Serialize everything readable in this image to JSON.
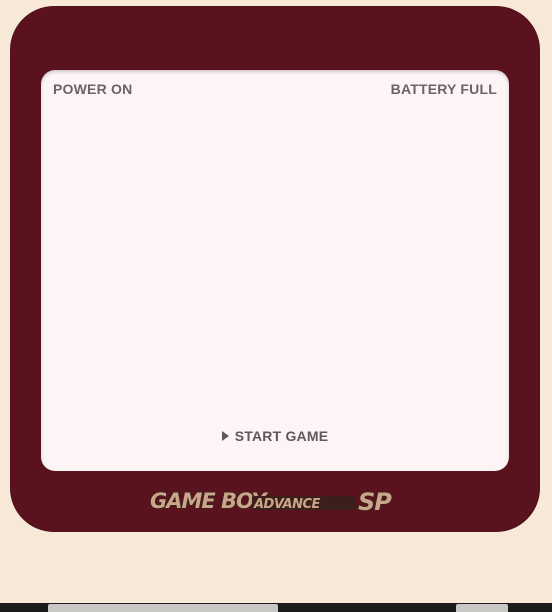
{
  "screen": {
    "status_left": "POWER ON",
    "status_right": "BATTERY FULL",
    "menu": {
      "selected_label": "START GAME",
      "cursor_icon": "play-triangle-icon"
    }
  },
  "logo": {
    "text_main": "GAME BOY",
    "text_advance": "ADVANCE",
    "text_sp": "SP"
  },
  "colors": {
    "shell": "#f8e8d8",
    "bezel": "#5a131e",
    "screen_bg": "#fdf4f6",
    "screen_text": "#6a6468",
    "logo_fill": "#c9a68a",
    "logo_stroke": "#3a1f1a"
  }
}
